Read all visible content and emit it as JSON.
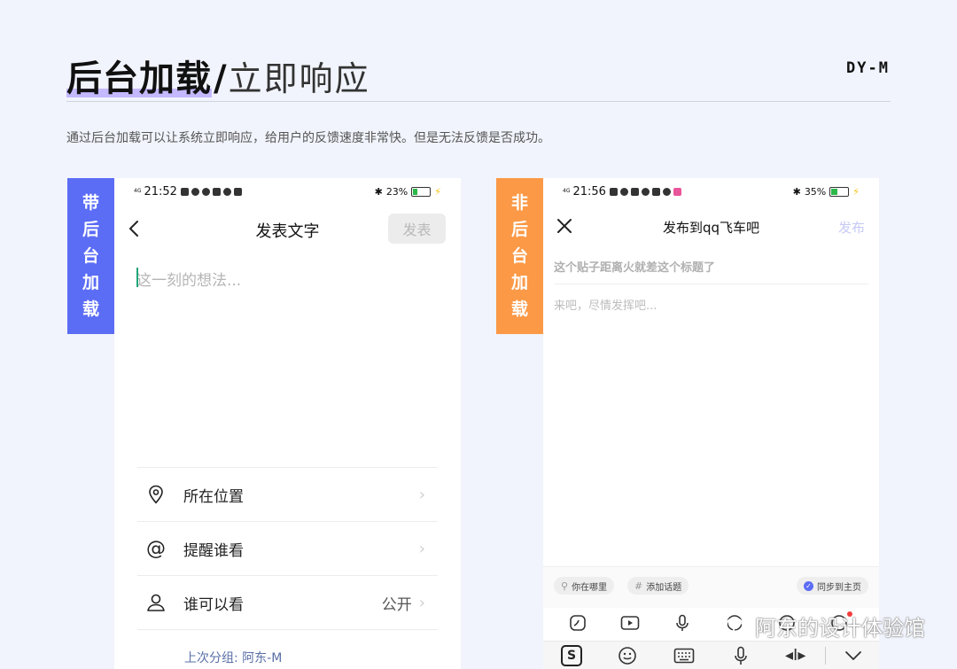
{
  "header": {
    "title_bold": "后台加载",
    "title_slash": "/",
    "title_light": "立即响应",
    "brand": "DY-M",
    "description": "通过后台加载可以让系统立即响应，给用户的反馈速度非常快。但是无法反馈是否成功。"
  },
  "tags": {
    "left": [
      "带",
      "后",
      "台",
      "加",
      "载"
    ],
    "right": [
      "非",
      "后",
      "台",
      "加",
      "载"
    ]
  },
  "left_phone": {
    "status": {
      "network": "4G",
      "time": "21:52",
      "battery": "23%",
      "battery_level": 0.23
    },
    "nav_title": "发表文字",
    "publish_label": "发表",
    "editor_placeholder": "这一刻的想法...",
    "rows": [
      {
        "icon": "location-pin-icon",
        "label": "所在位置",
        "value": ""
      },
      {
        "icon": "at-icon",
        "label": "提醒谁看",
        "value": ""
      },
      {
        "icon": "person-icon",
        "label": "谁可以看",
        "value": "公开"
      }
    ],
    "last_group": "上次分组: 阿东-M"
  },
  "right_phone": {
    "status": {
      "network": "4G",
      "time": "21:56",
      "battery": "35%",
      "battery_level": 0.35
    },
    "nav_title": "发布到qq飞车吧",
    "publish_label": "发布",
    "title_placeholder": "这个贴子距离火就差这个标题了",
    "content_placeholder": "来吧，尽情发挥吧...",
    "chips": {
      "location": "你在哪里",
      "topic": "添加话题",
      "sync": "同步到主页"
    },
    "toolbar_icons": [
      "sticker-icon",
      "video-icon",
      "mic-icon",
      "emoji-icon",
      "emoji-icon",
      "emoji-icon"
    ],
    "keyboard_icons": [
      "sogou-icon",
      "emoji-icon",
      "keyboard-icon",
      "mic-icon",
      "cursor-icon",
      "chevron-down-icon"
    ]
  },
  "watermark": "阿东的设计体验馆",
  "colors": {
    "background": "#f1f4fc",
    "tag_left": "#5b6cf5",
    "tag_right": "#fb9946",
    "highlight": "#c4b8ff",
    "caret": "#21a67a",
    "battery": "#2cb84a"
  }
}
